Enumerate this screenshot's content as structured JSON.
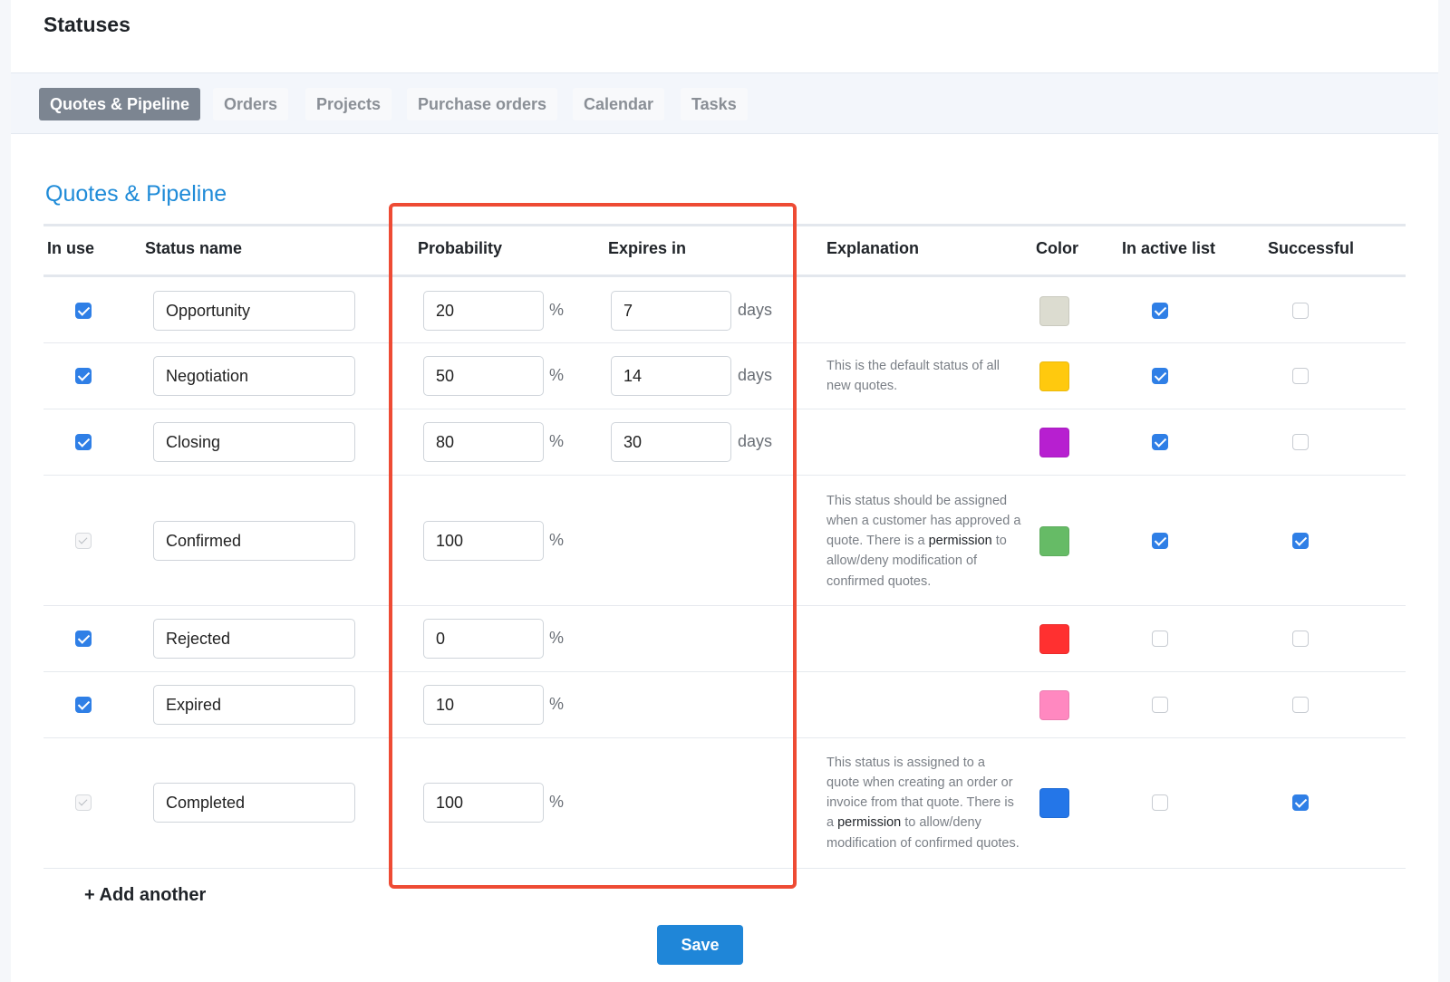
{
  "page_title": "Statuses",
  "tabs": [
    {
      "label": "Quotes & Pipeline",
      "active": true
    },
    {
      "label": "Orders",
      "active": false
    },
    {
      "label": "Projects",
      "active": false
    },
    {
      "label": "Purchase orders",
      "active": false
    },
    {
      "label": "Calendar",
      "active": false
    },
    {
      "label": "Tasks",
      "active": false
    }
  ],
  "section_title": "Quotes & Pipeline",
  "columns": {
    "in_use": "In use",
    "status_name": "Status name",
    "probability": "Probability",
    "expires_in": "Expires in",
    "explanation": "Explanation",
    "color": "Color",
    "in_active_list": "In active list",
    "successful": "Successful"
  },
  "units": {
    "percent": "%",
    "days": "days"
  },
  "rows": [
    {
      "in_use": "checked",
      "name": "Opportunity",
      "probability": "20",
      "expires": "7",
      "explanation": [],
      "color": "#dcdcd0",
      "in_active_list": true,
      "successful": false
    },
    {
      "in_use": "checked",
      "name": "Negotiation",
      "probability": "50",
      "expires": "14",
      "explanation": [
        {
          "text": "This is the default status of all new quotes."
        }
      ],
      "color": "#ffc90e",
      "in_active_list": true,
      "successful": false
    },
    {
      "in_use": "checked",
      "name": "Closing",
      "probability": "80",
      "expires": "30",
      "explanation": [],
      "color": "#b71fd0",
      "in_active_list": true,
      "successful": false
    },
    {
      "in_use": "disabled",
      "name": "Confirmed",
      "probability": "100",
      "expires": null,
      "explanation": [
        {
          "text": "This status should be assigned when a customer has approved a quote. There is a "
        },
        {
          "text": "permission",
          "link": true
        },
        {
          "text": " to allow/deny modification of confirmed quotes."
        }
      ],
      "color": "#66bb66",
      "in_active_list": true,
      "successful": true
    },
    {
      "in_use": "checked",
      "name": "Rejected",
      "probability": "0",
      "expires": null,
      "explanation": [],
      "color": "#ff3030",
      "in_active_list": false,
      "successful": false
    },
    {
      "in_use": "checked",
      "name": "Expired",
      "probability": "10",
      "expires": null,
      "explanation": [],
      "color": "#ff88c0",
      "in_active_list": false,
      "successful": false
    },
    {
      "in_use": "disabled",
      "name": "Completed",
      "probability": "100",
      "expires": null,
      "explanation": [
        {
          "text": "This status is assigned to a quote when creating an order or invoice from that quote. There is a "
        },
        {
          "text": "permission",
          "link": true
        },
        {
          "text": " to allow/deny modification of confirmed quotes."
        }
      ],
      "color": "#2476e8",
      "in_active_list": false,
      "successful": true
    }
  ],
  "add_another_label": "+ Add another",
  "save_label": "Save",
  "highlight_color": "#ee4b34"
}
